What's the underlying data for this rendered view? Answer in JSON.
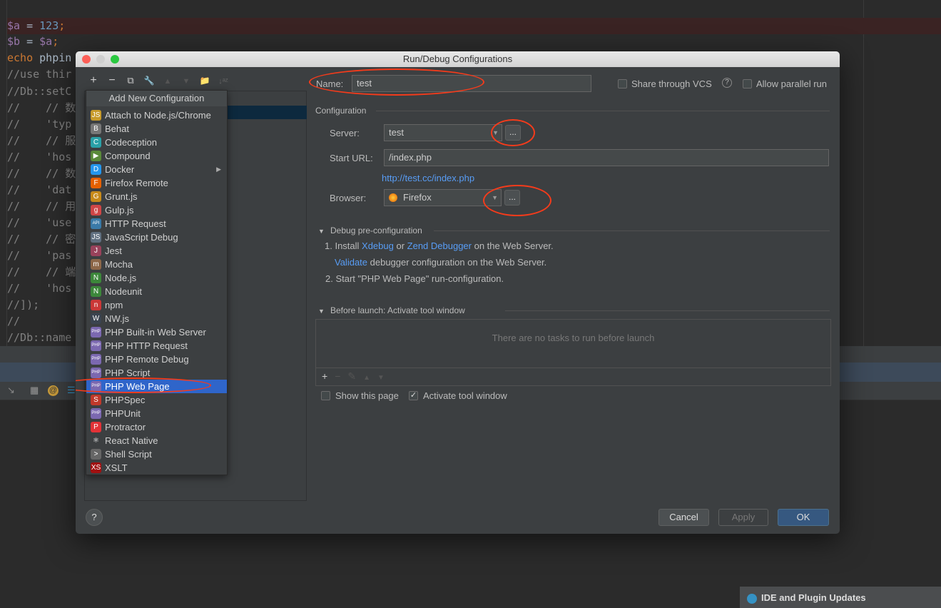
{
  "editor": {
    "lines": [
      {
        "parts": [
          [
            "var",
            "$a"
          ],
          [
            "pl",
            " = "
          ],
          [
            "num",
            "123"
          ],
          [
            "kw",
            ";"
          ]
        ]
      },
      {
        "parts": [
          [
            "var",
            "$b"
          ],
          [
            "pl",
            " = "
          ],
          [
            "var",
            "$a"
          ],
          [
            "kw",
            ";"
          ]
        ]
      },
      {
        "parts": [
          [
            "kw",
            "echo "
          ],
          [
            "pl",
            "phpin"
          ]
        ]
      },
      {
        "parts": [
          [
            "c",
            "//use thir"
          ]
        ]
      },
      {
        "parts": [
          [
            "c",
            "//Db::setC"
          ]
        ]
      },
      {
        "parts": [
          [
            "c",
            "//    // 数"
          ]
        ]
      },
      {
        "parts": [
          [
            "c",
            "//    'typ"
          ]
        ]
      },
      {
        "parts": [
          [
            "c",
            "//    // 服"
          ]
        ]
      },
      {
        "parts": [
          [
            "c",
            "//    'hos"
          ]
        ]
      },
      {
        "parts": [
          [
            "c",
            "//    // 数"
          ]
        ]
      },
      {
        "parts": [
          [
            "c",
            "//    'dat"
          ]
        ]
      },
      {
        "parts": [
          [
            "c",
            "//    // 用"
          ]
        ]
      },
      {
        "parts": [
          [
            "c",
            "//    'use"
          ]
        ]
      },
      {
        "parts": [
          [
            "c",
            "//    // 密"
          ]
        ]
      },
      {
        "parts": [
          [
            "c",
            "//    'pas"
          ]
        ]
      },
      {
        "parts": [
          [
            "c",
            "//    // 端"
          ]
        ]
      },
      {
        "parts": [
          [
            "c",
            "//    'hos"
          ]
        ]
      },
      {
        "parts": [
          [
            "c",
            "//]);"
          ]
        ]
      },
      {
        "parts": [
          [
            "c",
            "//"
          ]
        ]
      },
      {
        "parts": [
          [
            "c",
            "//Db::name"
          ]
        ]
      }
    ]
  },
  "notification": {
    "title": "IDE and Plugin Updates"
  },
  "dialog": {
    "title": "Run/Debug Configurations",
    "toolbar": {
      "add": "+",
      "remove": "−",
      "copy": "⧉",
      "edit": "🔧",
      "up": "▲",
      "down": "▼",
      "folder": "📁",
      "sort": "↓ᵃᶻ"
    },
    "popup": {
      "header": "Add New Configuration",
      "selected": "PHP Web Page",
      "items": [
        {
          "label": "Attach to Node.js/Chrome",
          "icon": "JS",
          "color": "#c79a2a"
        },
        {
          "label": "Behat",
          "icon": "B",
          "color": "#777"
        },
        {
          "label": "Codeception",
          "icon": "C",
          "color": "#2aa1a8"
        },
        {
          "label": "Compound",
          "icon": "▶",
          "color": "#5a8a3a"
        },
        {
          "label": "Docker",
          "icon": "D",
          "color": "#2496ed",
          "submenu": true
        },
        {
          "label": "Firefox Remote",
          "icon": "F",
          "color": "#e66000"
        },
        {
          "label": "Grunt.js",
          "icon": "G",
          "color": "#c78a1a"
        },
        {
          "label": "Gulp.js",
          "icon": "g",
          "color": "#cf4647"
        },
        {
          "label": "HTTP Request",
          "icon": "API",
          "color": "#3a7aa8"
        },
        {
          "label": "JavaScript Debug",
          "icon": "JS",
          "color": "#607080"
        },
        {
          "label": "Jest",
          "icon": "J",
          "color": "#99425b"
        },
        {
          "label": "Mocha",
          "icon": "m",
          "color": "#8d6748"
        },
        {
          "label": "Node.js",
          "icon": "N",
          "color": "#3c873a"
        },
        {
          "label": "Nodeunit",
          "icon": "N",
          "color": "#3c873a"
        },
        {
          "label": "npm",
          "icon": "n",
          "color": "#cb3837"
        },
        {
          "label": "NW.js",
          "icon": "W",
          "color": "#3b4450"
        },
        {
          "label": "PHP Built-in Web Server",
          "icon": "PHP",
          "color": "#7b68b0"
        },
        {
          "label": "PHP HTTP Request",
          "icon": "PHP",
          "color": "#7b68b0"
        },
        {
          "label": "PHP Remote Debug",
          "icon": "PHP",
          "color": "#7b68b0"
        },
        {
          "label": "PHP Script",
          "icon": "PHP",
          "color": "#7b68b0"
        },
        {
          "label": "PHP Web Page",
          "icon": "PHP",
          "color": "#7b68b0"
        },
        {
          "label": "PHPSpec",
          "icon": "S",
          "color": "#c0392b"
        },
        {
          "label": "PHPUnit",
          "icon": "PHP",
          "color": "#7b68b0"
        },
        {
          "label": "Protractor",
          "icon": "P",
          "color": "#e23237"
        },
        {
          "label": "React Native",
          "icon": "⚛",
          "color": "#3c3f41"
        },
        {
          "label": "Shell Script",
          "icon": ">",
          "color": "#666"
        },
        {
          "label": "XSLT",
          "icon": "XS",
          "color": "#a01010"
        }
      ]
    },
    "name_label": "Name:",
    "name_value": "test",
    "share_vcs": {
      "label": "Share through VCS",
      "checked": false
    },
    "help_glyph": "?",
    "allow_parallel": {
      "label": "Allow parallel run",
      "checked": false
    },
    "configuration_label": "Configuration",
    "server_label": "Server:",
    "server_value": "test",
    "start_url_label": "Start URL:",
    "start_url_value": "/index.php",
    "resolved_url": "http://test.cc/index.php",
    "browser_label": "Browser:",
    "browser_value": "Firefox",
    "ellipsis": "...",
    "debug_section": "Debug pre-configuration",
    "debug_steps": {
      "s1a": "1. Install ",
      "xdebug": "Xdebug",
      "or": " or ",
      "zend": "Zend Debugger",
      "s1b": " on the Web Server.",
      "validate": "Validate",
      "s1c": " debugger configuration on the Web Server.",
      "s2": "2. Start \"PHP Web Page\" run-configuration."
    },
    "before_launch_section": "Before launch: Activate tool window",
    "no_tasks": "There are no tasks to run before launch",
    "task_tools": {
      "add": "+",
      "remove": "−",
      "edit": "✎",
      "up": "▲",
      "down": "▼"
    },
    "show_page": {
      "label": "Show this page",
      "checked": false
    },
    "activate_window": {
      "label": "Activate tool window",
      "checked": true
    },
    "buttons": {
      "cancel": "Cancel",
      "apply": "Apply",
      "ok": "OK",
      "help": "?"
    }
  },
  "colors": {
    "accent": "#2f65ca",
    "annotation": "#f53b1b",
    "link": "#589df6"
  }
}
